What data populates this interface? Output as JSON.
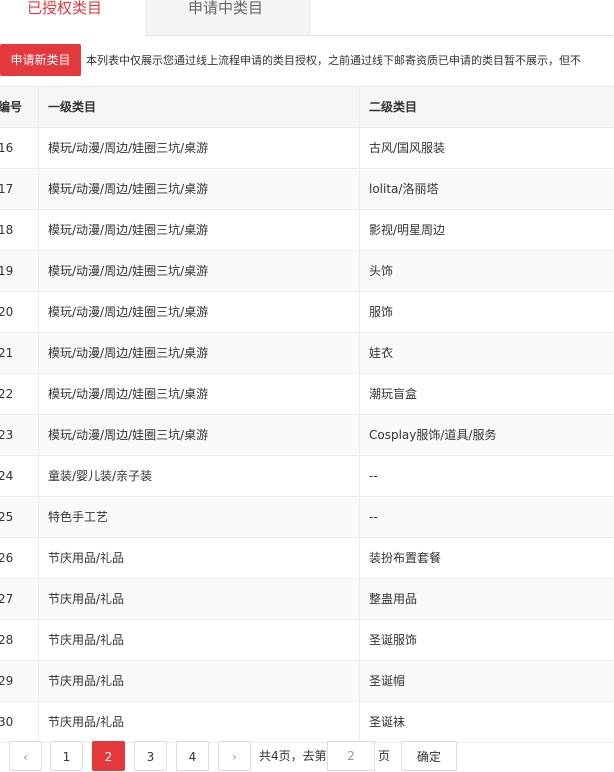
{
  "tabs": [
    {
      "label": "已授权类目",
      "active": true
    },
    {
      "label": "申请中类目",
      "active": false
    }
  ],
  "apply_button": "申请新类目",
  "notice": "本列表中仅展示您通过线上流程申请的类目授权，之前通过线下邮寄资质已申请的类目暂不展示，但不",
  "columns": [
    "编号",
    "一级类目",
    "二级类目"
  ],
  "rows": [
    {
      "num": "16",
      "level1": "模玩/动漫/周边/娃圈三坑/桌游",
      "level2": "古风/国风服装"
    },
    {
      "num": "17",
      "level1": "模玩/动漫/周边/娃圈三坑/桌游",
      "level2": "lolita/洛丽塔"
    },
    {
      "num": "18",
      "level1": "模玩/动漫/周边/娃圈三坑/桌游",
      "level2": "影视/明星周边"
    },
    {
      "num": "19",
      "level1": "模玩/动漫/周边/娃圈三坑/桌游",
      "level2": "头饰"
    },
    {
      "num": "20",
      "level1": "模玩/动漫/周边/娃圈三坑/桌游",
      "level2": "服饰"
    },
    {
      "num": "21",
      "level1": "模玩/动漫/周边/娃圈三坑/桌游",
      "level2": "娃衣"
    },
    {
      "num": "22",
      "level1": "模玩/动漫/周边/娃圈三坑/桌游",
      "level2": "潮玩盲盒"
    },
    {
      "num": "23",
      "level1": "模玩/动漫/周边/娃圈三坑/桌游",
      "level2": "Cosplay服饰/道具/服务"
    },
    {
      "num": "24",
      "level1": "童装/婴儿装/亲子装",
      "level2": "--"
    },
    {
      "num": "25",
      "level1": "特色手工艺",
      "level2": "--"
    },
    {
      "num": "26",
      "level1": "节庆用品/礼品",
      "level2": "装扮布置套餐"
    },
    {
      "num": "27",
      "level1": "节庆用品/礼品",
      "level2": "整蛊用品"
    },
    {
      "num": "28",
      "level1": "节庆用品/礼品",
      "level2": "圣诞服饰"
    },
    {
      "num": "29",
      "level1": "节庆用品/礼品",
      "level2": "圣诞帽"
    },
    {
      "num": "30",
      "level1": "节庆用品/礼品",
      "level2": "圣诞袜"
    }
  ],
  "pagination": {
    "prev": "‹",
    "next": "›",
    "pages": [
      "1",
      "2",
      "3",
      "4"
    ],
    "current": "2",
    "total_text": "共4页，去第",
    "goto_value": "2",
    "page_unit": "页",
    "confirm": "确定"
  },
  "colors": {
    "accent": "#e4393c"
  }
}
